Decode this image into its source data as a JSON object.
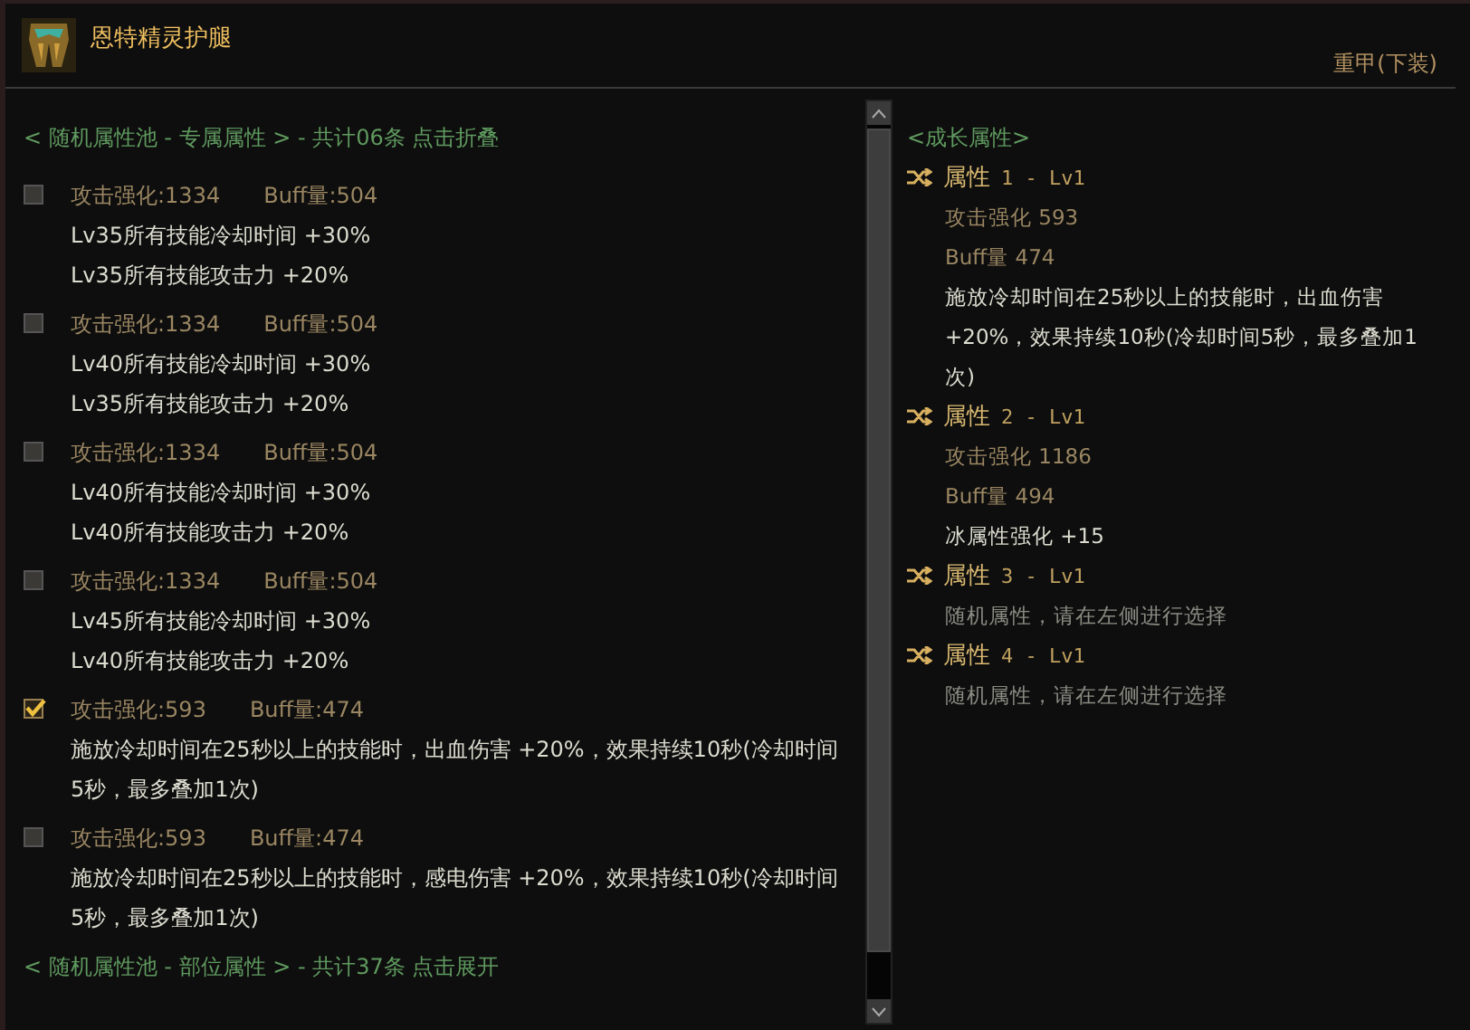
{
  "header": {
    "title": "恩特精灵护腿",
    "category": "重甲(下装)"
  },
  "left": {
    "pool_header": "< 随机属性池 - 专属属性 > - 共计06条 点击折叠",
    "options": [
      {
        "checked": false,
        "attack": "攻击强化:1334",
        "buff": "Buff量:504",
        "effects": [
          "Lv35所有技能冷却时间 +30%",
          "Lv35所有技能攻击力 +20%"
        ]
      },
      {
        "checked": false,
        "attack": "攻击强化:1334",
        "buff": "Buff量:504",
        "effects": [
          "Lv40所有技能冷却时间 +30%",
          "Lv35所有技能攻击力 +20%"
        ]
      },
      {
        "checked": false,
        "attack": "攻击强化:1334",
        "buff": "Buff量:504",
        "effects": [
          "Lv40所有技能冷却时间 +30%",
          "Lv40所有技能攻击力 +20%"
        ]
      },
      {
        "checked": false,
        "attack": "攻击强化:1334",
        "buff": "Buff量:504",
        "effects": [
          "Lv45所有技能冷却时间 +30%",
          "Lv40所有技能攻击力 +20%"
        ]
      },
      {
        "checked": true,
        "attack": "攻击强化:593",
        "buff": "Buff量:474",
        "effects": [
          "施放冷却时间在25秒以上的技能时，出血伤害 +20%，效果持续10秒(冷却时间5秒，最多叠加1次)"
        ]
      },
      {
        "checked": false,
        "attack": "攻击强化:593",
        "buff": "Buff量:474",
        "effects": [
          "施放冷却时间在25秒以上的技能时，感电伤害 +20%，效果持续10秒(冷却时间5秒，最多叠加1次)"
        ]
      }
    ],
    "pool_footer": "< 随机属性池 - 部位属性 > - 共计37条 点击展开"
  },
  "right": {
    "title": "<成长属性>",
    "attributes": [
      {
        "name": "属性",
        "level": "1 - Lv1",
        "lines": [
          {
            "kind": "stat",
            "text": "攻击强化 593"
          },
          {
            "kind": "stat",
            "text": "Buff量 474"
          },
          {
            "kind": "effect",
            "text": "施放冷却时间在25秒以上的技能时，出血伤害 +20%，效果持续10秒(冷却时间5秒，最多叠加1次)"
          }
        ]
      },
      {
        "name": "属性",
        "level": "2 - Lv1",
        "lines": [
          {
            "kind": "stat",
            "text": "攻击强化 1186"
          },
          {
            "kind": "stat",
            "text": "Buff量 494"
          },
          {
            "kind": "effect",
            "text": "冰属性强化 +15"
          }
        ]
      },
      {
        "name": "属性",
        "level": "3 - Lv1",
        "lines": [
          {
            "kind": "hint",
            "text": "随机属性，请在左侧进行选择"
          }
        ]
      },
      {
        "name": "属性",
        "level": "4 - Lv1",
        "lines": [
          {
            "kind": "hint",
            "text": "随机属性，请在左侧进行选择"
          }
        ]
      }
    ]
  }
}
